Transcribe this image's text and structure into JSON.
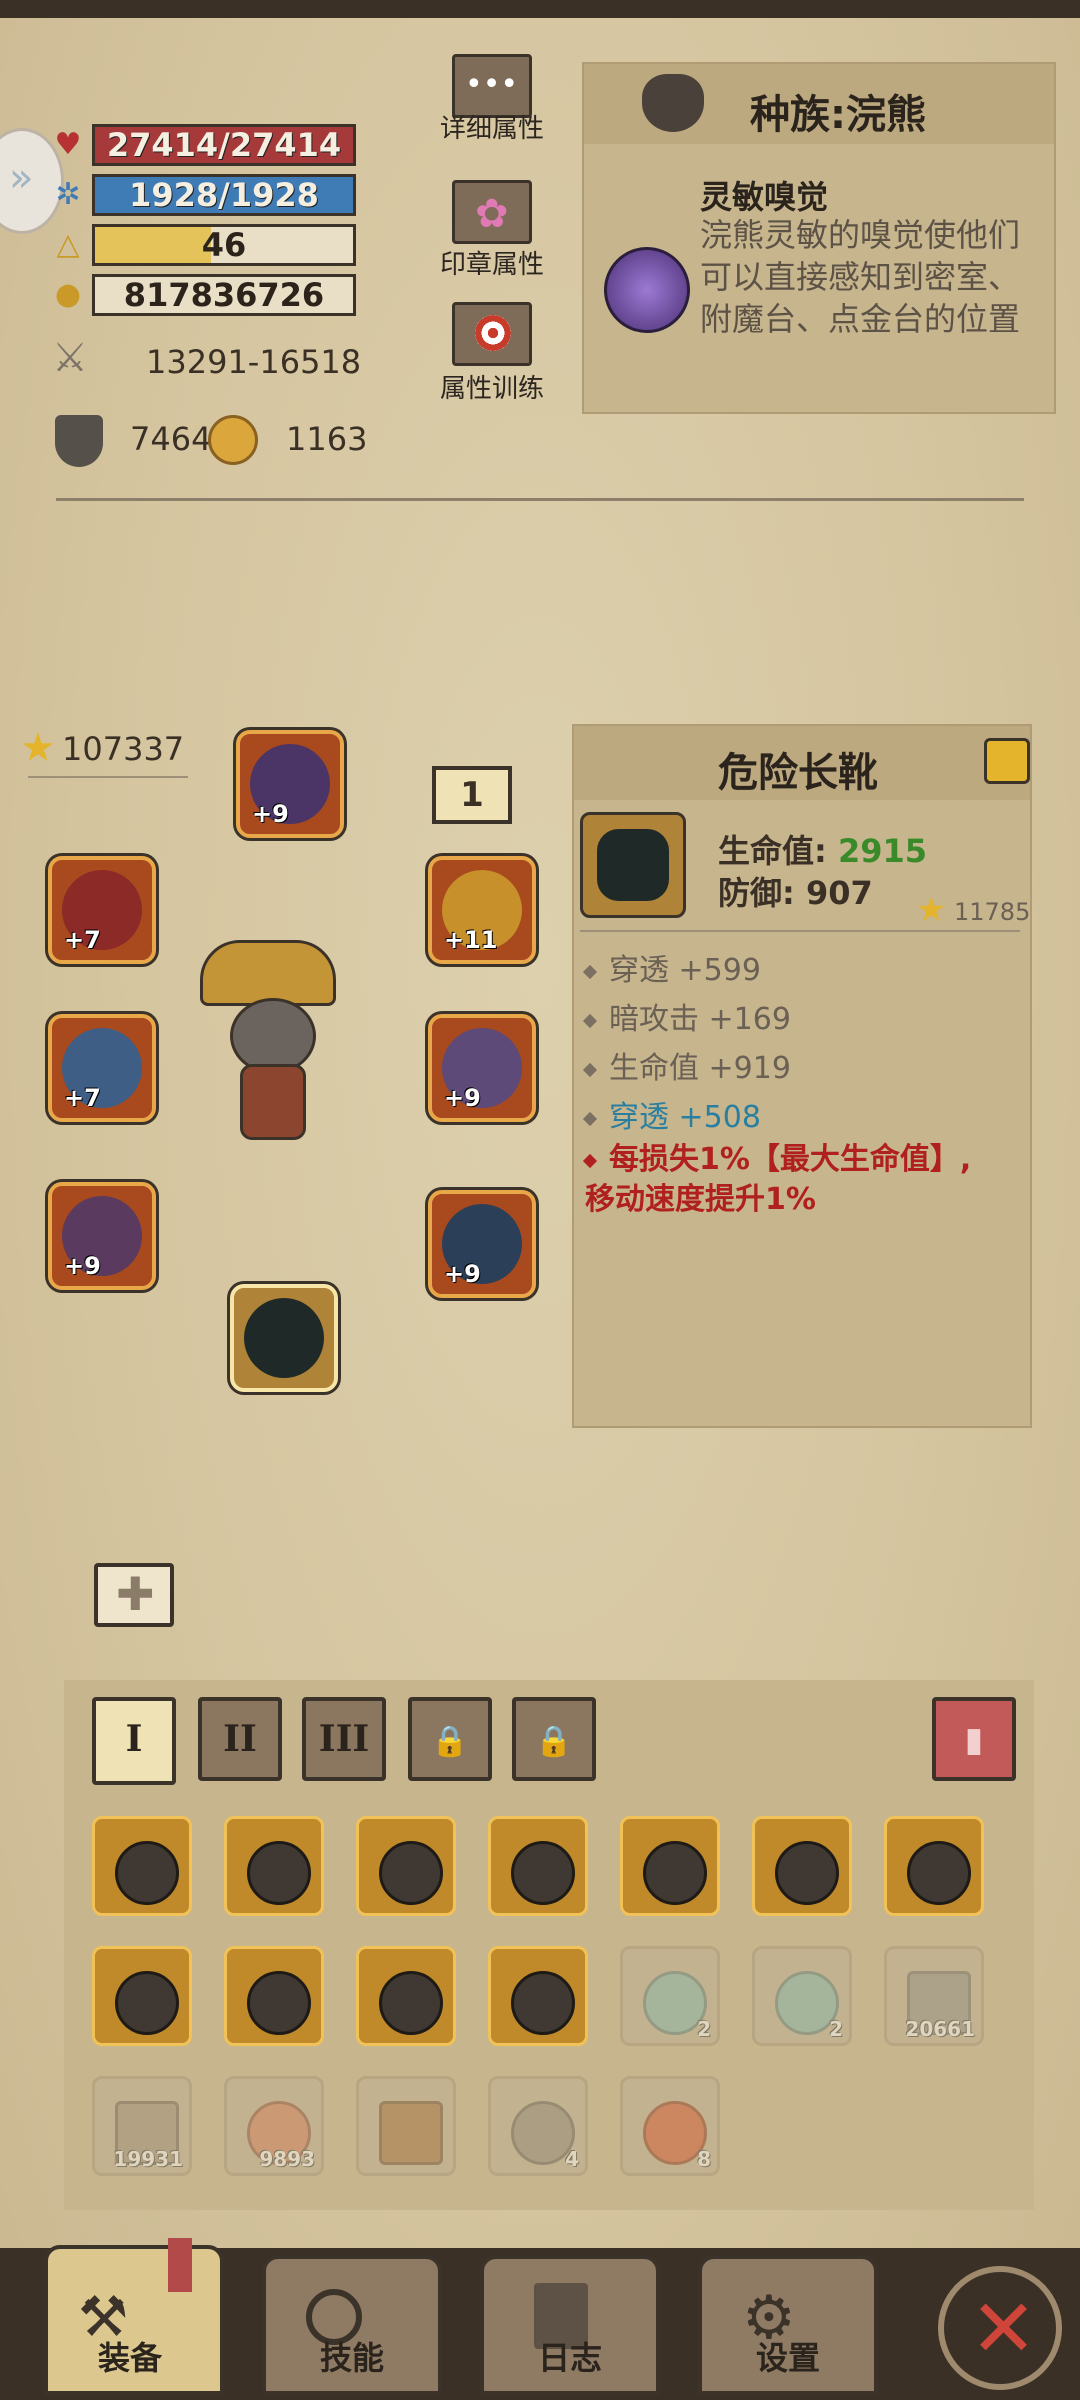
{
  "stats": {
    "hp": "27414/27414",
    "mp": "1928/1928",
    "level": "46",
    "gold": "817836726",
    "attack": "13291-16518",
    "armor": "7464",
    "dodge": "1163"
  },
  "side_buttons": {
    "detail": "详细属性",
    "seal": "印章属性",
    "training": "属性训练"
  },
  "race": {
    "title": "种族:浣熊",
    "skill_name": "灵敏嗅觉",
    "skill_desc": "浣熊灵敏的嗅觉使他们可以直接感知到密室、附魔台、点金台的位置"
  },
  "equipment": {
    "power": "107337",
    "loadout_number": "1",
    "slots": {
      "helmet_plus": "+9",
      "left1_plus": "+7",
      "left2_plus": "+7",
      "left3_plus": "+9",
      "right1_plus": "+11",
      "right2_plus": "+9",
      "right3_plus": "+9"
    }
  },
  "item": {
    "name": "危险长靴",
    "hp_label": "生命值:",
    "hp_value": "2915",
    "def_label": "防御:",
    "def_value": "907",
    "score": "11785",
    "attrs": [
      "穿透 +599",
      "暗攻击 +169",
      "生命值 +919"
    ],
    "special_label": "穿透",
    "special_value": "+508",
    "effect": "每损失1%【最大生命值】,移动速度提升1%"
  },
  "tabs": [
    "I",
    "II",
    "III"
  ],
  "inventory": {
    "counts": [
      "2",
      "2",
      "20661",
      "19931",
      "9893",
      "",
      "4",
      "8"
    ]
  },
  "bottom_nav": {
    "equip": "装备",
    "skill": "技能",
    "log": "日志",
    "settings": "设置"
  },
  "colors": {
    "hp_bar": "#a63a3a",
    "mp_bar": "#3f7bb5",
    "xp_bar": "#e3c35a",
    "green_value": "#3a8a2a",
    "blue_value": "#2a7fa0",
    "red_effect": "#b0201e"
  }
}
